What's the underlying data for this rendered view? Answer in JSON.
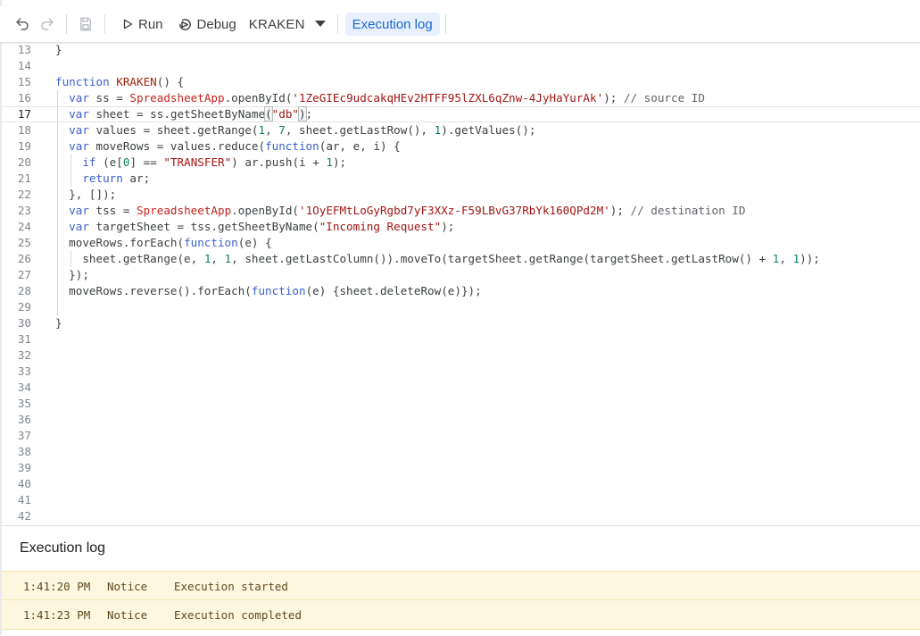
{
  "toolbar": {
    "run_label": "Run",
    "debug_label": "Debug",
    "function_select": "KRAKEN",
    "execution_log_label": "Execution log"
  },
  "editor": {
    "current_line": 17,
    "lines": [
      {
        "n": "13",
        "segments": [
          {
            "t": "}",
            "c": "p"
          }
        ]
      },
      {
        "n": "14",
        "segments": []
      },
      {
        "n": "15",
        "segments": [
          {
            "t": "function ",
            "c": "kw"
          },
          {
            "t": "KRAKEN",
            "c": "fn"
          },
          {
            "t": "() {",
            "c": "p"
          }
        ]
      },
      {
        "n": "16",
        "segments": [
          {
            "t": "  ",
            "c": "p"
          },
          {
            "t": "var",
            "c": "kw"
          },
          {
            "t": " ss = ",
            "c": "p"
          },
          {
            "t": "SpreadsheetApp",
            "c": "cls"
          },
          {
            "t": ".openById(",
            "c": "p"
          },
          {
            "t": "'1ZeGIEc9udcakqHEv2HTFF95lZXL6qZnw-4JyHaYurAk'",
            "c": "str"
          },
          {
            "t": "); ",
            "c": "p"
          },
          {
            "t": "// source ID",
            "c": "cm"
          }
        ]
      },
      {
        "n": "17",
        "segments": [
          {
            "t": "  ",
            "c": "p"
          },
          {
            "t": "var",
            "c": "kw"
          },
          {
            "t": " sheet = ss.getSheetByName",
            "c": "p"
          },
          {
            "t": "(",
            "c": "br"
          },
          {
            "t": "\"db\"",
            "c": "str"
          },
          {
            "t": ")",
            "c": "br"
          },
          {
            "t": ";",
            "c": "p"
          }
        ]
      },
      {
        "n": "18",
        "segments": [
          {
            "t": "  ",
            "c": "p"
          },
          {
            "t": "var",
            "c": "kw"
          },
          {
            "t": " values = sheet.getRange(",
            "c": "p"
          },
          {
            "t": "1",
            "c": "num"
          },
          {
            "t": ", ",
            "c": "p"
          },
          {
            "t": "7",
            "c": "num"
          },
          {
            "t": ", sheet.getLastRow(), ",
            "c": "p"
          },
          {
            "t": "1",
            "c": "num"
          },
          {
            "t": ").getValues();",
            "c": "p"
          }
        ]
      },
      {
        "n": "19",
        "segments": [
          {
            "t": "  ",
            "c": "p"
          },
          {
            "t": "var",
            "c": "kw"
          },
          {
            "t": " moveRows = values.reduce(",
            "c": "p"
          },
          {
            "t": "function",
            "c": "kw"
          },
          {
            "t": "(ar, e, i) {",
            "c": "p"
          }
        ]
      },
      {
        "n": "20",
        "segments": [
          {
            "t": "    ",
            "c": "p"
          },
          {
            "t": "if",
            "c": "kw"
          },
          {
            "t": " (e[",
            "c": "p"
          },
          {
            "t": "0",
            "c": "num"
          },
          {
            "t": "] == ",
            "c": "p"
          },
          {
            "t": "\"TRANSFER\"",
            "c": "str"
          },
          {
            "t": ") ar.push(i + ",
            "c": "p"
          },
          {
            "t": "1",
            "c": "num"
          },
          {
            "t": ");",
            "c": "p"
          }
        ]
      },
      {
        "n": "21",
        "segments": [
          {
            "t": "    ",
            "c": "p"
          },
          {
            "t": "return",
            "c": "kw"
          },
          {
            "t": " ar;",
            "c": "p"
          }
        ]
      },
      {
        "n": "22",
        "segments": [
          {
            "t": "  }, []);",
            "c": "p"
          }
        ]
      },
      {
        "n": "23",
        "segments": [
          {
            "t": "  ",
            "c": "p"
          },
          {
            "t": "var",
            "c": "kw"
          },
          {
            "t": " tss = ",
            "c": "p"
          },
          {
            "t": "SpreadsheetApp",
            "c": "cls"
          },
          {
            "t": ".openById(",
            "c": "p"
          },
          {
            "t": "'1OyEFMtLoGyRgbd7yF3XXz-F59LBvG37RbYk160QPd2M'",
            "c": "str"
          },
          {
            "t": "); ",
            "c": "p"
          },
          {
            "t": "// destination ID",
            "c": "cm"
          }
        ]
      },
      {
        "n": "24",
        "segments": [
          {
            "t": "  ",
            "c": "p"
          },
          {
            "t": "var",
            "c": "kw"
          },
          {
            "t": " targetSheet = tss.getSheetByName(",
            "c": "p"
          },
          {
            "t": "\"Incoming Request\"",
            "c": "str"
          },
          {
            "t": ");",
            "c": "p"
          }
        ]
      },
      {
        "n": "25",
        "segments": [
          {
            "t": "  moveRows.forEach(",
            "c": "p"
          },
          {
            "t": "function",
            "c": "kw"
          },
          {
            "t": "(e) {",
            "c": "p"
          }
        ]
      },
      {
        "n": "26",
        "segments": [
          {
            "t": "    sheet.getRange(e, ",
            "c": "p"
          },
          {
            "t": "1",
            "c": "num"
          },
          {
            "t": ", ",
            "c": "p"
          },
          {
            "t": "1",
            "c": "num"
          },
          {
            "t": ", sheet.getLastColumn()).moveTo(targetSheet.getRange(targetSheet.getLastRow() + ",
            "c": "p"
          },
          {
            "t": "1",
            "c": "num"
          },
          {
            "t": ", ",
            "c": "p"
          },
          {
            "t": "1",
            "c": "num"
          },
          {
            "t": "));",
            "c": "p"
          }
        ]
      },
      {
        "n": "27",
        "segments": [
          {
            "t": "  });",
            "c": "p"
          }
        ]
      },
      {
        "n": "28",
        "segments": [
          {
            "t": "  moveRows.reverse().forEach(",
            "c": "p"
          },
          {
            "t": "function",
            "c": "kw"
          },
          {
            "t": "(e) {sheet.deleteRow(e)});",
            "c": "p"
          }
        ]
      },
      {
        "n": "29",
        "segments": []
      },
      {
        "n": "30",
        "segments": [
          {
            "t": "}",
            "c": "p"
          }
        ]
      },
      {
        "n": "31",
        "segments": []
      },
      {
        "n": "32",
        "segments": []
      },
      {
        "n": "33",
        "segments": []
      },
      {
        "n": "34",
        "segments": []
      },
      {
        "n": "35",
        "segments": []
      },
      {
        "n": "36",
        "segments": []
      },
      {
        "n": "37",
        "segments": []
      },
      {
        "n": "38",
        "segments": []
      },
      {
        "n": "39",
        "segments": []
      },
      {
        "n": "40",
        "segments": []
      },
      {
        "n": "41",
        "segments": []
      },
      {
        "n": "42",
        "segments": []
      }
    ]
  },
  "execution_log": {
    "title": "Execution log",
    "entries": [
      {
        "time": "1:41:20 PM",
        "level": "Notice",
        "message": "Execution started"
      },
      {
        "time": "1:41:23 PM",
        "level": "Notice",
        "message": "Execution completed"
      }
    ]
  },
  "colors": {
    "accent": "#1967d2",
    "chip_bg": "#e8f0fe",
    "log_bg": "#fef7e0",
    "keyword": "#3a5fcd",
    "string": "#a31515",
    "number": "#098658"
  }
}
